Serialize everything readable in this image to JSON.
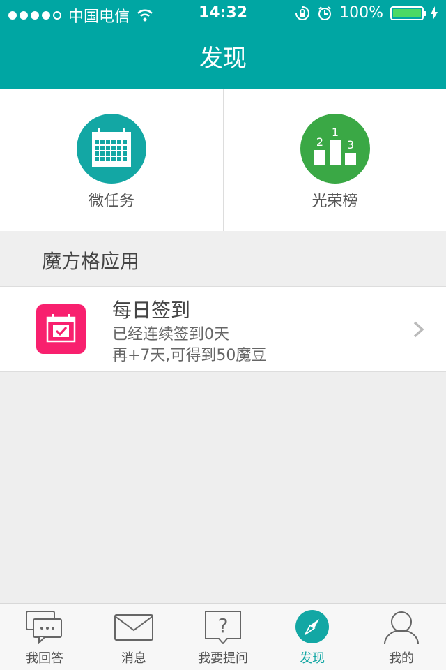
{
  "status_bar": {
    "carrier": "中国电信",
    "time": "14:32",
    "battery": "100%",
    "icons": [
      "signal-dots-icon",
      "wifi-icon",
      "rotation-lock-icon",
      "alarm-icon",
      "battery-icon",
      "charging-bolt-icon"
    ]
  },
  "nav": {
    "title": "发现"
  },
  "features": [
    {
      "label": "微任务",
      "icon": "calendar-grid-icon"
    },
    {
      "label": "光荣榜",
      "icon": "podium-icon"
    }
  ],
  "section": {
    "title": "魔方格应用"
  },
  "list_item": {
    "title": "每日签到",
    "line1": "已经连续签到0天",
    "line2": "再+7天,可得到50魔豆",
    "icon": "calendar-check-icon"
  },
  "tabs": [
    {
      "label": "我回答",
      "icon": "chat-bubbles-icon"
    },
    {
      "label": "消息",
      "icon": "envelope-icon"
    },
    {
      "label": "我要提问",
      "icon": "question-bubble-icon"
    },
    {
      "label": "发现",
      "icon": "compass-icon",
      "active": true
    },
    {
      "label": "我的",
      "icon": "user-icon"
    }
  ],
  "colors": {
    "primary": "#00a6a3",
    "green": "#3aa845",
    "pink": "#f8206e",
    "background": "#eeeeee"
  }
}
